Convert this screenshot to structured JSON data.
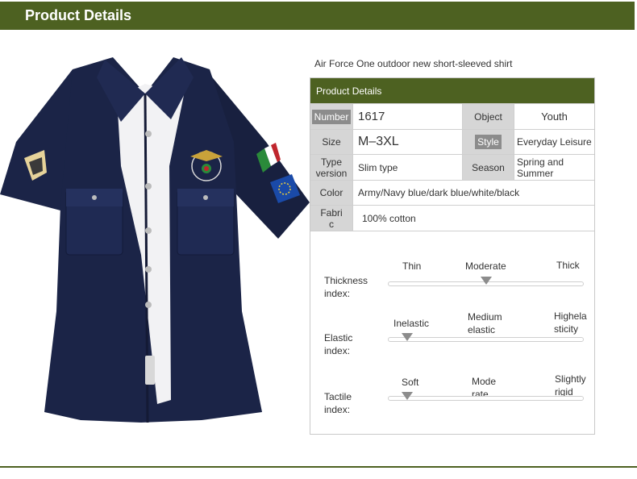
{
  "header": {
    "title": "Product Details"
  },
  "product": {
    "subtitle": "Air Force One outdoor new short-sleeved shirt"
  },
  "panel": {
    "title": "Product Details"
  },
  "specs": {
    "number_label": "Number",
    "number_value": "1617",
    "object_label": "Object",
    "object_value": "Youth",
    "size_label": "Size",
    "size_value": "M–3XL",
    "style_label": "Style",
    "style_value": "Everyday Leisure",
    "type_label": "Type version",
    "type_value": "Slim type",
    "season_label": "Season",
    "season_value": "Spring and Summer",
    "color_label": "Color",
    "color_value": "Army/Navy blue/dark blue/white/black",
    "fabric_label": "Fabri c",
    "fabric_value": "100% cotton"
  },
  "indices": [
    {
      "label": "Thickness index:",
      "options": [
        "Thin",
        "Moderate",
        "Thick"
      ],
      "selected": "Moderate",
      "level": 0.5
    },
    {
      "label": "Elastic index:",
      "options": [
        "Inelastic",
        "Medium elastic",
        "Highela sticity"
      ],
      "selected": "Inelastic",
      "level": 0.1
    },
    {
      "label": "Tactile index:",
      "options": [
        "Soft",
        "Mode rate",
        "Slightly rigid"
      ],
      "selected": "Soft",
      "level": 0.1
    }
  ],
  "colors": {
    "accent": "#4d6121",
    "label_bg": "#d6d6d6",
    "marker": "#8c8c8c",
    "shirt": "#1b2447"
  },
  "icons": {
    "shirt": "navy-short-sleeve-shirt-image",
    "eagle": "eagle-badge-icon",
    "italy": "italy-flag-patch-icon",
    "eu": "eu-flag-patch-icon"
  }
}
